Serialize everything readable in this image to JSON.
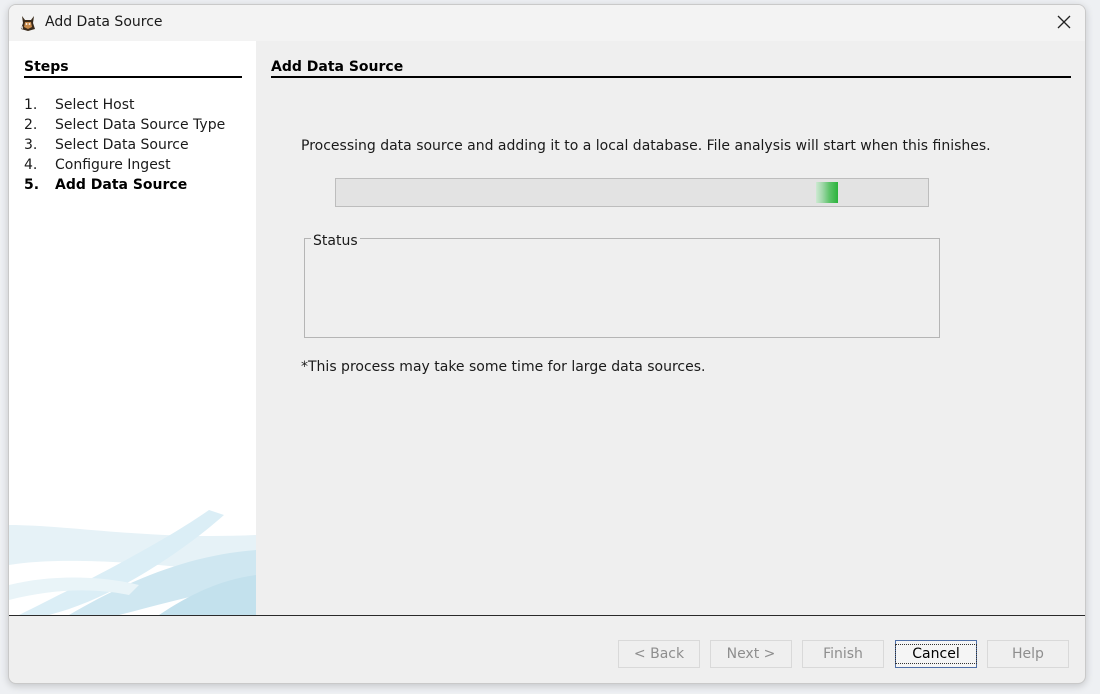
{
  "window": {
    "title": "Add Data Source",
    "app_icon": "autopsy-dog-icon",
    "close_icon": "close-icon"
  },
  "sidebar": {
    "heading": "Steps",
    "steps": [
      {
        "num": "1.",
        "label": "Select Host",
        "current": false
      },
      {
        "num": "2.",
        "label": "Select Data Source Type",
        "current": false
      },
      {
        "num": "3.",
        "label": "Select Data Source",
        "current": false
      },
      {
        "num": "4.",
        "label": "Configure Ingest",
        "current": false
      },
      {
        "num": "5.",
        "label": "Add Data Source",
        "current": true
      }
    ]
  },
  "main": {
    "heading": "Add Data Source",
    "processing_text": "Processing data source and adding it to a local database. File analysis will start when this finishes.",
    "progress": {
      "mode": "indeterminate",
      "chunk_fraction": 0.83,
      "color": "#2bb33c"
    },
    "status_label": "Status",
    "note": "*This process may take some time for large data sources."
  },
  "buttons": {
    "back": {
      "label": "< Back",
      "enabled": false
    },
    "next": {
      "label": "Next >",
      "enabled": false
    },
    "finish": {
      "label": "Finish",
      "enabled": false
    },
    "cancel": {
      "label": "Cancel",
      "enabled": true
    },
    "help": {
      "label": "Help",
      "enabled": false
    }
  }
}
